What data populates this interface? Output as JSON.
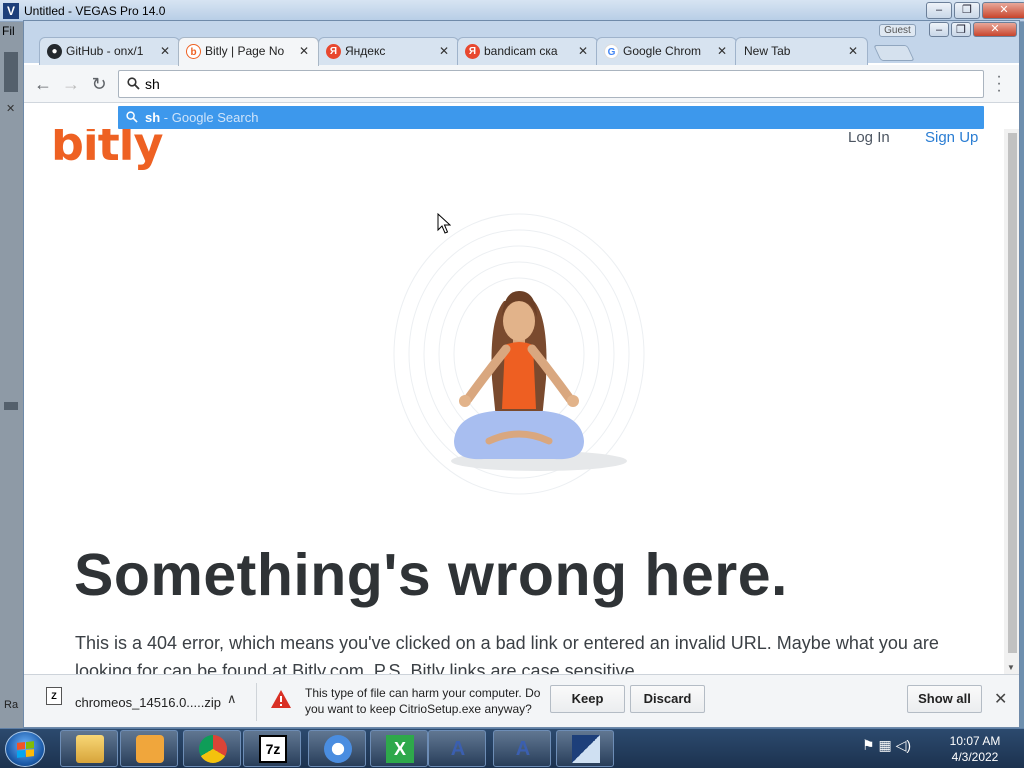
{
  "vegas": {
    "title": "Untitled - VEGAS Pro 14.0",
    "menu_first": "Fil",
    "side_label": "Ra"
  },
  "chrome": {
    "guest_label": "Guest",
    "tabs": [
      {
        "label": "GitHub - onx/1",
        "icon": "github-icon"
      },
      {
        "label": "Bitly | Page No",
        "icon": "bitly-icon",
        "active": true
      },
      {
        "label": "Яндекс",
        "icon": "yandex-icon"
      },
      {
        "label": "bandicam ска",
        "icon": "yandex-icon"
      },
      {
        "label": "Google Chrom",
        "icon": "google-icon"
      },
      {
        "label": "New Tab",
        "icon": ""
      }
    ],
    "omnibox_value": "sh",
    "suggestion": {
      "query": "sh",
      "separator": " - ",
      "suffix": "Google Search"
    }
  },
  "page": {
    "logo": "bitly",
    "login": "Log In",
    "signup": "Sign Up",
    "headline": "Something's wrong here.",
    "body": "This is a 404 error, which means you've clicked on a bad link or entered an invalid URL. Maybe what you are looking for can be found at Bitly.com. P.S. Bitly links are case sensitive."
  },
  "download_bar": {
    "file_name": "chromeos_14516.0.....zip",
    "warning": "This type of file can harm your computer. Do you want to keep CitrioSetup.exe anyway?",
    "keep_label": "Keep",
    "discard_label": "Discard",
    "show_all_label": "Show all"
  },
  "taskbar": {
    "time": "10:07 AM",
    "date": "4/3/2022",
    "apps": [
      "explorer",
      "media-player",
      "chrome",
      "7zip",
      "chromium",
      "excel",
      "app-a1",
      "app-a2",
      "vegas"
    ]
  },
  "colors": {
    "bitly_orange": "#ee6123",
    "suggest_blue": "#3d98ec",
    "link_blue": "#2a7dd3"
  }
}
